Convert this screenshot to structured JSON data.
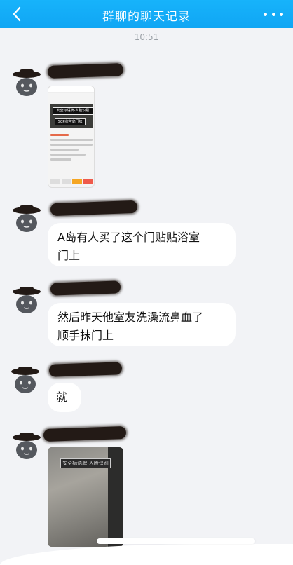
{
  "header": {
    "title": "群聊的聊天记录",
    "back_icon": "chevron-left-icon",
    "more_icon": "more-dots-icon",
    "bg_color": "#12abf7"
  },
  "timestamp": "10:51",
  "messages": [
    {
      "type": "image",
      "image_text": [
        "安全标语牌-人脸识别",
        "SCP收容室门牌"
      ]
    },
    {
      "type": "text",
      "lines": [
        "A岛有人买了这个门贴贴浴室",
        "门上"
      ]
    },
    {
      "type": "text",
      "lines": [
        "然后昨天他室友洗澡流鼻血了",
        "顺手抹门上"
      ]
    },
    {
      "type": "text",
      "lines": [
        "就"
      ]
    },
    {
      "type": "image",
      "image_text": [
        "安全标语牌-人脸识别"
      ]
    }
  ]
}
